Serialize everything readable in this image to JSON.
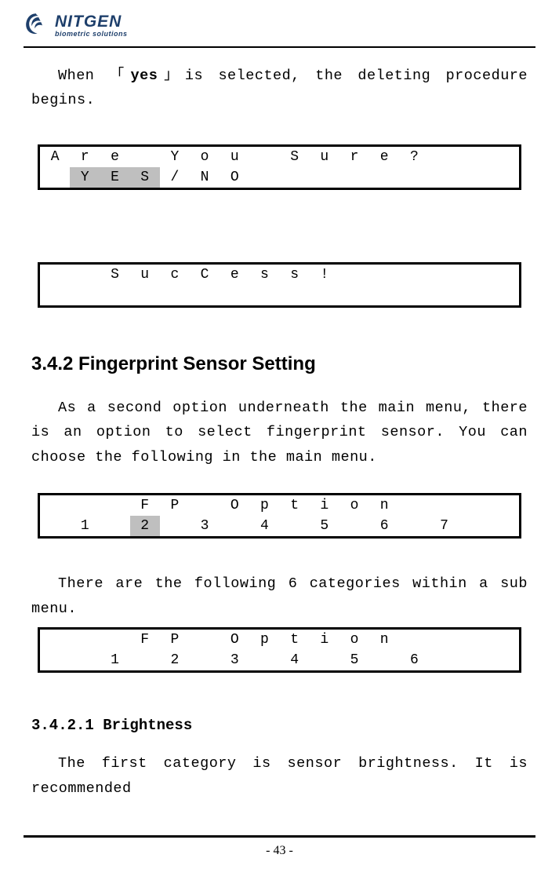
{
  "logo": {
    "main": "NITGEN",
    "sub": "biometric solutions"
  },
  "para1_pre": "When 「",
  "para1_yes": "yes",
  "para1_post": "」is selected, the deleting procedure begins.",
  "lcd1": {
    "row1": [
      "A",
      "r",
      "e",
      "",
      "Y",
      "o",
      "u",
      "",
      "S",
      "u",
      "r",
      "e",
      "?",
      "",
      "",
      ""
    ],
    "row2": [
      "",
      "Y",
      "E",
      "S",
      "/",
      "N",
      "O",
      "",
      "",
      "",
      "",
      "",
      "",
      "",
      "",
      ""
    ],
    "row2_inv": [
      false,
      true,
      true,
      true,
      false,
      false,
      false,
      false,
      false,
      false,
      false,
      false,
      false,
      false,
      false,
      false
    ]
  },
  "lcd2": {
    "row1": [
      "",
      "",
      "S",
      "u",
      "c",
      "C",
      "e",
      "s",
      "s",
      "!",
      "",
      "",
      "",
      "",
      "",
      ""
    ],
    "row2": [
      "",
      "",
      "",
      "",
      "",
      "",
      "",
      "",
      "",
      "",
      "",
      "",
      "",
      "",
      "",
      ""
    ]
  },
  "h2": "3.4.2 Fingerprint Sensor Setting",
  "para2": "As a second option underneath the main menu, there is an option to select fingerprint sensor. You can choose the following in the main menu.",
  "lcd3": {
    "row1": [
      "",
      "",
      "",
      "F",
      "P",
      "",
      "O",
      "p",
      "t",
      "i",
      "o",
      "n",
      "",
      "",
      "",
      ""
    ],
    "row2": [
      "",
      "1",
      "",
      "2",
      "",
      "3",
      "",
      "4",
      "",
      "5",
      "",
      "6",
      "",
      "7",
      "",
      ""
    ],
    "row2_inv": [
      false,
      false,
      false,
      true,
      false,
      false,
      false,
      false,
      false,
      false,
      false,
      false,
      false,
      false,
      false,
      false
    ]
  },
  "para3": "There are the following 6 categories within a sub menu.",
  "lcd4": {
    "row1": [
      "",
      "",
      "",
      "F",
      "P",
      "",
      "O",
      "p",
      "t",
      "i",
      "o",
      "n",
      "",
      "",
      "",
      ""
    ],
    "row2": [
      "",
      "",
      "1",
      "",
      "2",
      "",
      "3",
      "",
      "4",
      "",
      "5",
      "",
      "6",
      "",
      "",
      ""
    ]
  },
  "h3": "3.4.2.1 Brightness",
  "para4": "The first category is sensor brightness. It is recommended",
  "page_num": "- 43 -"
}
